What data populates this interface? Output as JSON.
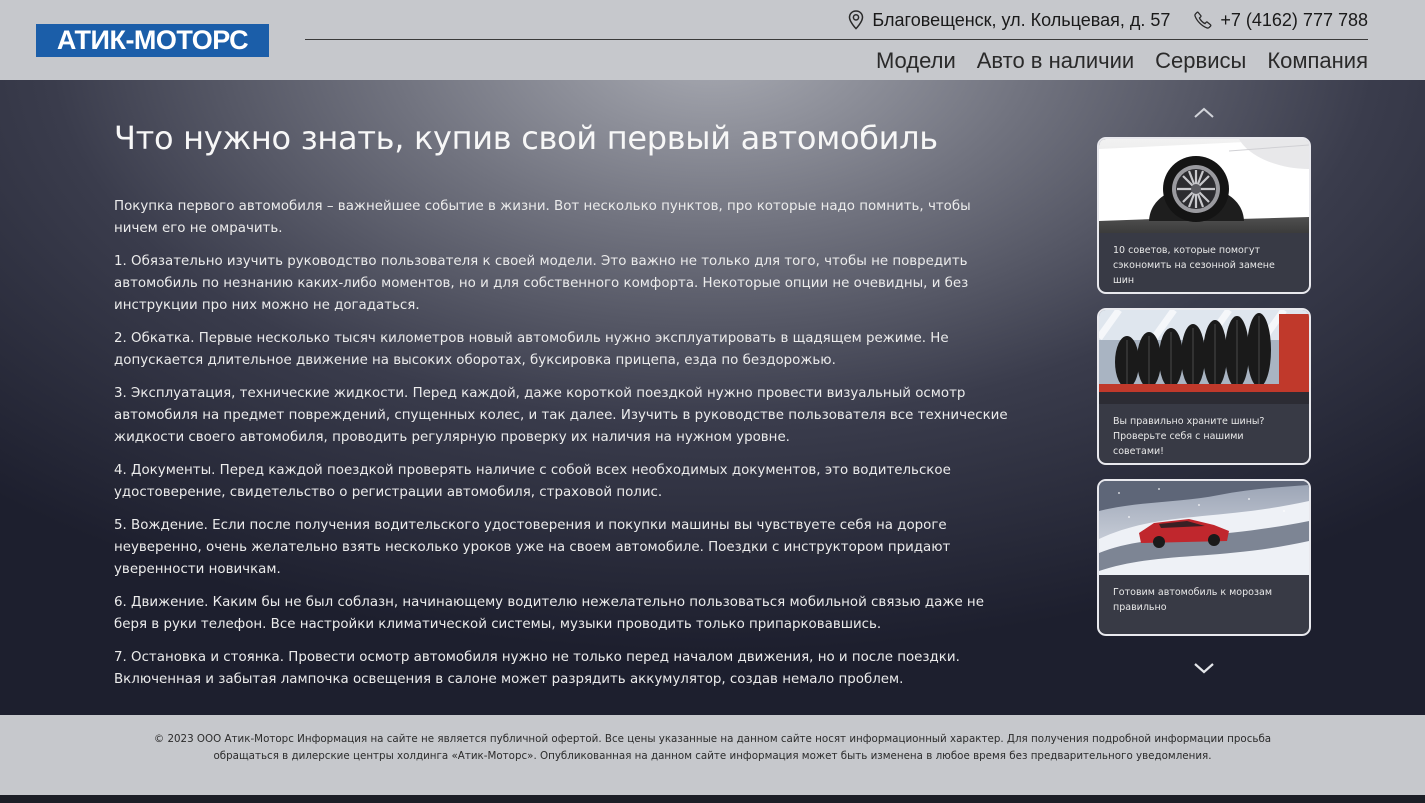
{
  "header": {
    "logo": "АТИК-МОТОРС",
    "address": "Благовещенск, ул. Кольцевая, д. 57",
    "phone": "+7 (4162) 777 788",
    "nav": [
      "Модели",
      "Авто в наличии",
      "Сервисы",
      "Компания"
    ],
    "address_icon": "location-pin-icon",
    "phone_icon": "phone-icon"
  },
  "article": {
    "title": "Что нужно знать, купив свой первый автомобиль",
    "paragraphs": [
      "Покупка первого автомобиля – важнейшее событие в жизни. Вот несколько пунктов, про которые надо помнить, чтобы ничем его не омрачить.",
      "1. Обязательно изучить руководство пользователя к своей модели. Это важно не только для того, чтобы не повредить автомобиль по незнанию каких-либо моментов, но и для собственного комфорта. Некоторые опции не очевидны, и без инструкции про них можно не догадаться.",
      "2. Обкатка. Первые несколько тысяч километров новый автомобиль нужно эксплуатировать в щадящем режиме. Не допускается длительное движение на высоких оборотах, буксировка прицепа, езда по бездорожью.",
      "3. Эксплуатация, технические жидкости. Перед каждой, даже короткой поездкой нужно провести визуальный осмотр автомобиля на предмет повреждений, спущенных колес, и так далее. Изучить в руководстве пользователя все технические жидкости своего автомобиля, проводить регулярную проверку их наличия на нужном уровне.",
      "4. Документы. Перед каждой поездкой проверять наличие с собой всех необходимых документов, это водительское удостоверение, свидетельство о регистрации автомобиля, страховой полис.",
      "5. Вождение. Если после получения водительского удостоверения и покупки машины вы чувствуете себя на дороге неуверенно, очень желательно взять несколько уроков уже на своем автомобиле. Поездки с инструктором придают уверенности новичкам.",
      "6. Движение. Каким бы не был соблазн, начинающему водителю нежелательно пользоваться мобильной связью даже не беря в руки телефон. Все настройки климатической системы, музыки проводить только припарковавшись.",
      "7. Остановка и стоянка. Провести осмотр автомобиля нужно не только перед началом движения, но и после поездки. Включенная и забытая лампочка освещения в салоне может разрядить аккумулятор, создав немало проблем."
    ]
  },
  "sidebar": {
    "up_icon": "chevron-up-icon",
    "down_icon": "chevron-down-icon",
    "cards": [
      {
        "title": "10 советов, которые помогут сэкономить на сезонной замене шин",
        "image": "white-car-wheel-photo"
      },
      {
        "title": "Вы правильно храните шины? Проверьте себя с нашими советами!",
        "image": "tire-storage-rack-photo"
      },
      {
        "title": "Готовим автомобиль к морозам правильно",
        "image": "red-car-winter-road-photo"
      }
    ]
  },
  "footer": {
    "text": "© 2023 ООО Атик-Моторс Информация на сайте не является публичной офертой. Все цены указанные на данном сайте носят информационный характер. Для получения подробной информации просьба обращаться в дилерские центры холдинга «Атик-Моторс». Опубликованная на данном сайте информация может быть изменена в любое время без предварительного уведомления."
  },
  "colors": {
    "header_bg": "#c6c8cc",
    "logo_bg": "#1b5ea9",
    "main_bg_dark": "#1d1f2e",
    "card_border": "#e9e9ee"
  }
}
